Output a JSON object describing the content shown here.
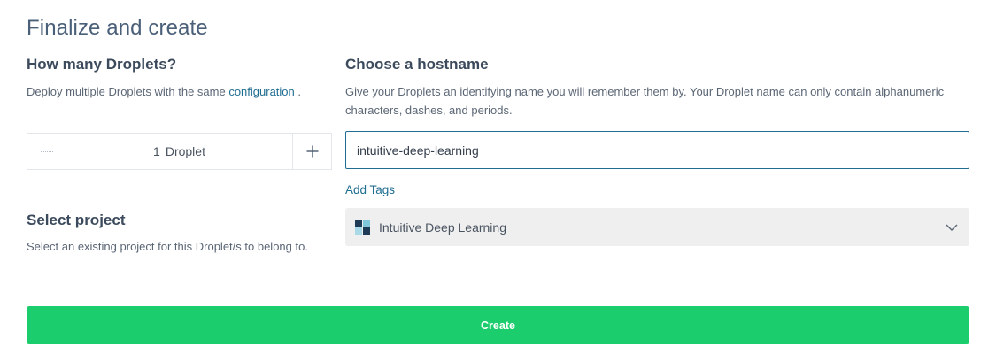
{
  "page": {
    "title": "Finalize and create"
  },
  "droplets": {
    "heading": "How many Droplets?",
    "desc_prefix": "Deploy multiple Droplets with the same ",
    "desc_link": "configuration",
    "desc_suffix": " .",
    "count": "1",
    "unit": "Droplet",
    "plus_label": "+"
  },
  "hostname": {
    "heading": "Choose a hostname",
    "desc": "Give your Droplets an identifying name you will remember them by. Your Droplet name can only contain alphanumeric characters, dashes, and periods.",
    "value": "intuitive-deep-learning",
    "add_tags": "Add Tags"
  },
  "project": {
    "heading": "Select project",
    "desc": "Select an existing project for this Droplet/s to belong to.",
    "selected": "Intuitive Deep Learning",
    "icon_colors": [
      "#1f3b55",
      "#7fc7d9",
      "#a9d8e6",
      "#1f3b55"
    ]
  },
  "actions": {
    "create_label": "Create"
  },
  "colors": {
    "accent": "#1f6d91",
    "create": "#1ccd6d"
  }
}
